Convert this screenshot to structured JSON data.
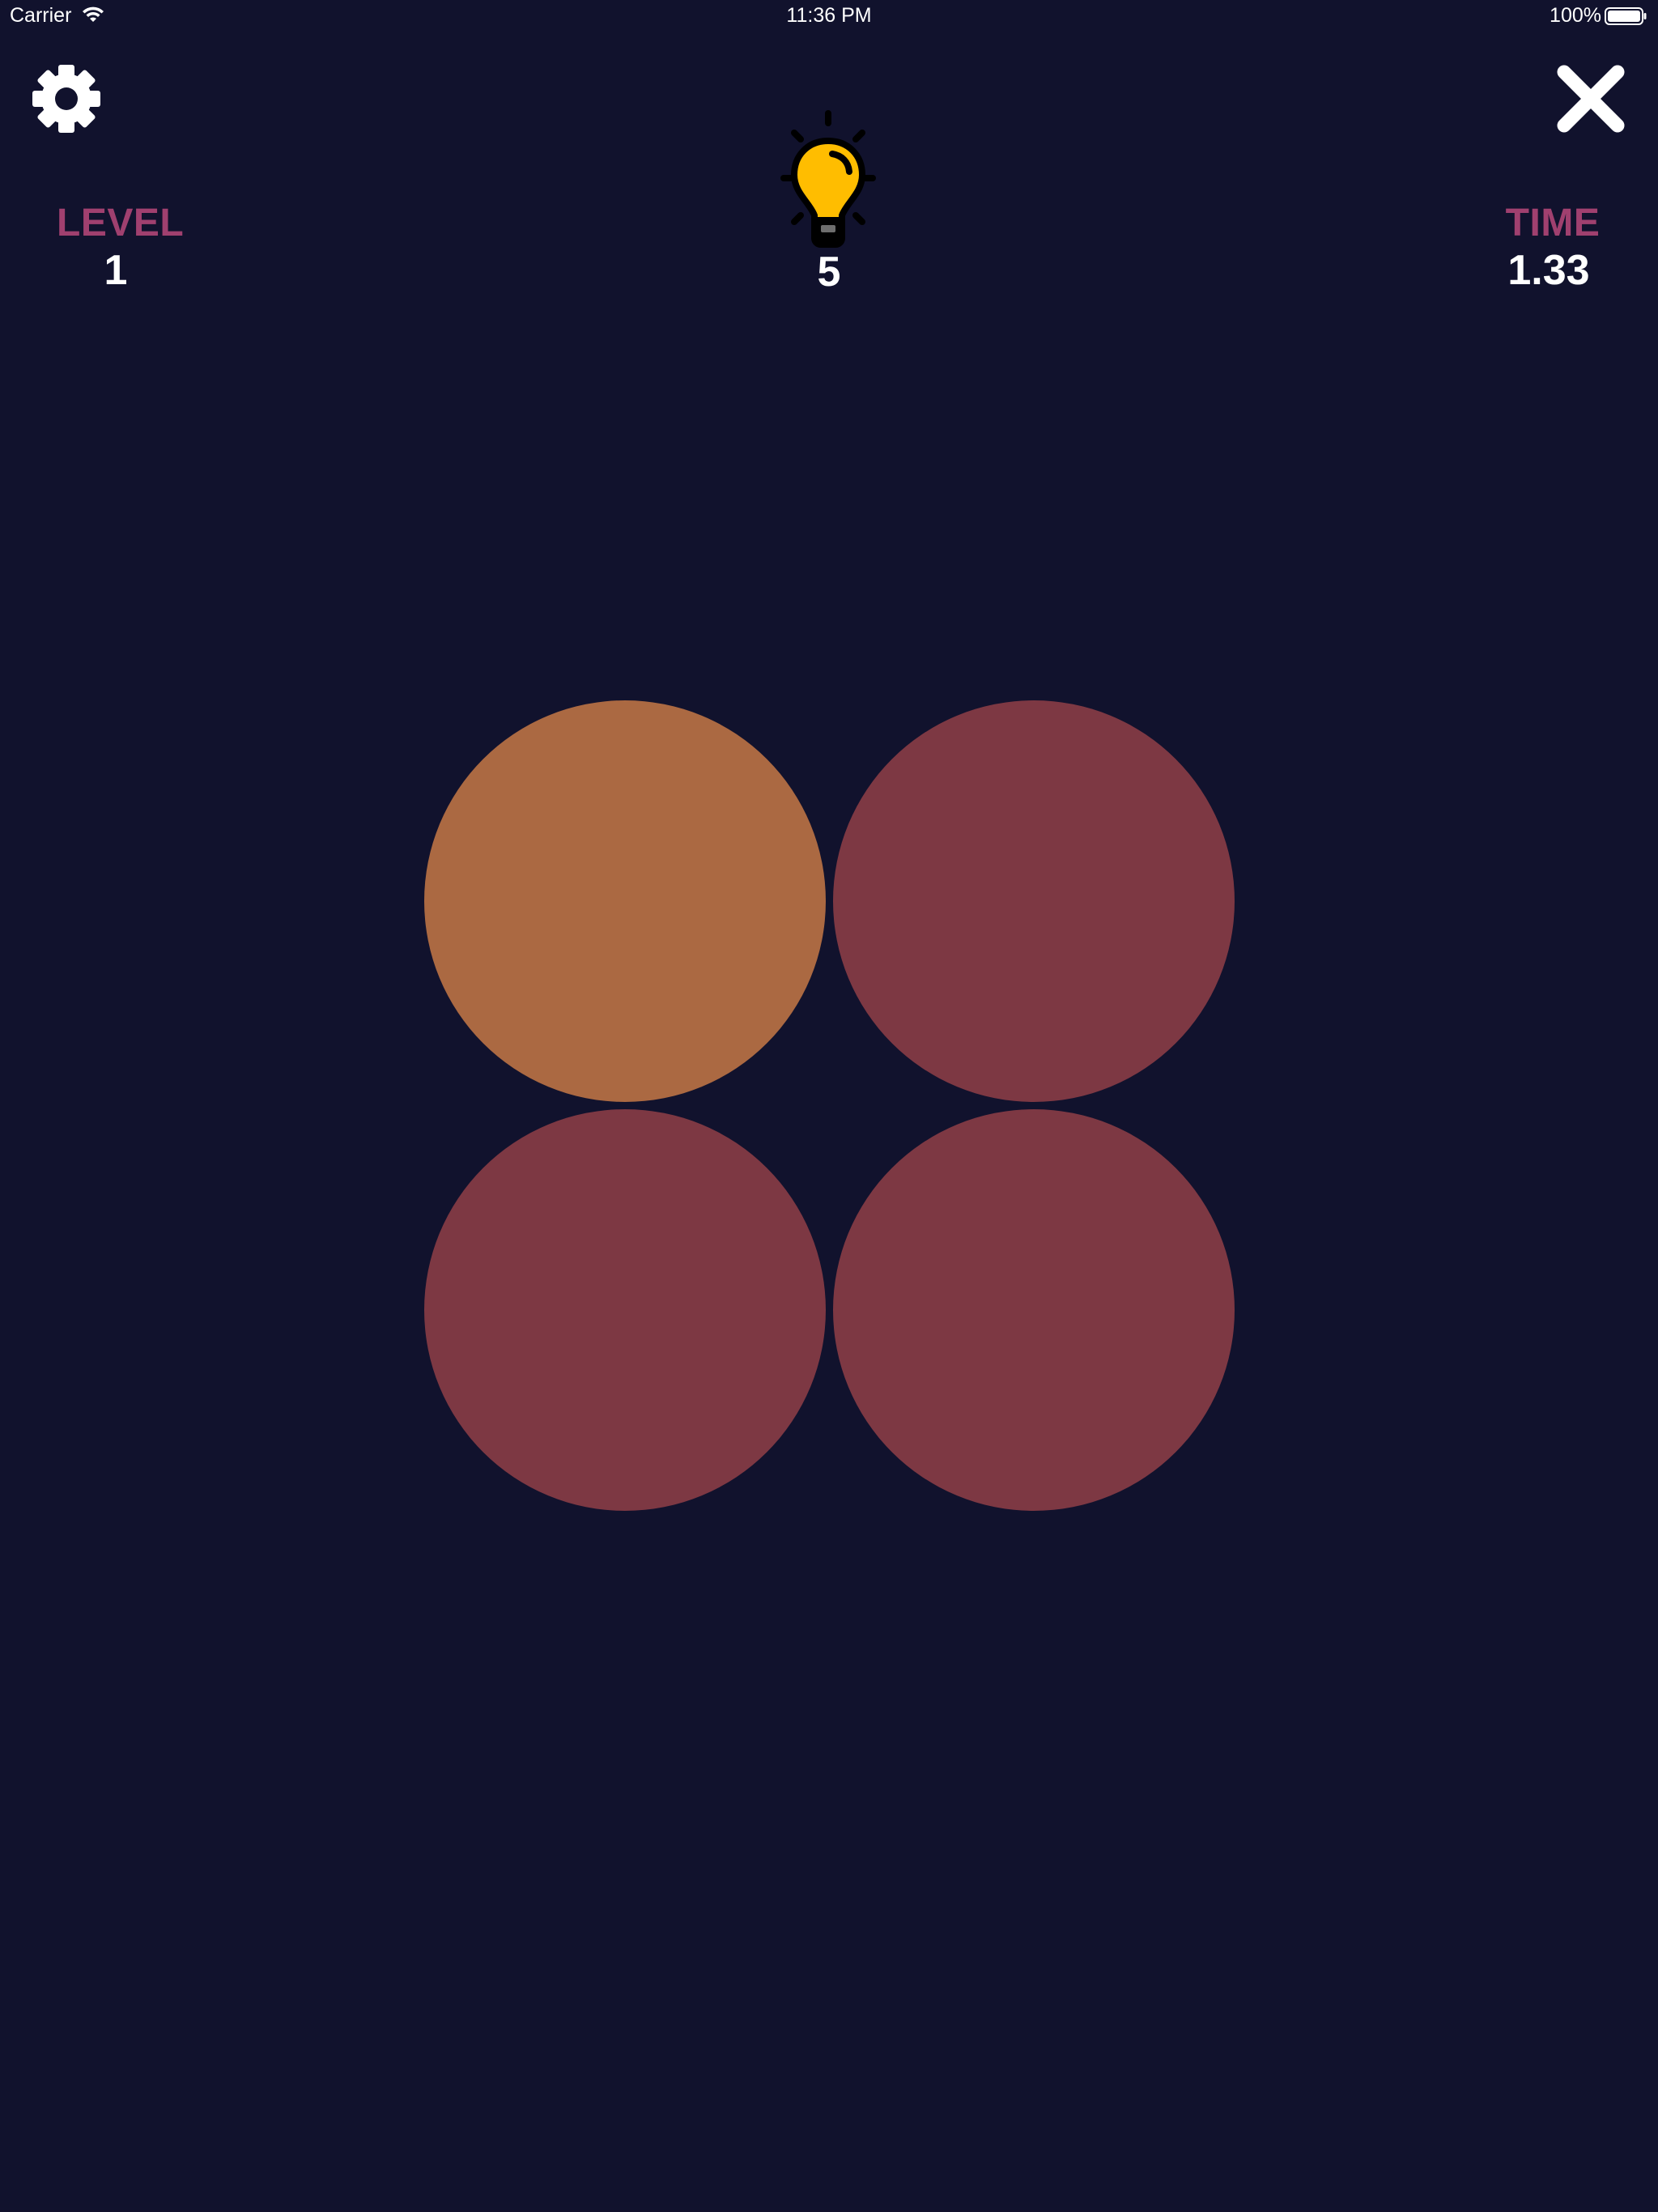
{
  "status_bar": {
    "carrier": "Carrier",
    "time": "11:36 PM",
    "battery": "100%"
  },
  "header": {
    "settings_icon": "gear-icon",
    "close_icon": "close-icon",
    "hint_icon": "lightbulb-icon",
    "level_label": "LEVEL",
    "level_value": "1",
    "time_label": "TIME",
    "time_value": "1.33",
    "hints_value": "5"
  },
  "colors": {
    "background": "#11122d",
    "label_accent": "#a0406f",
    "bulb": "#ffbd00",
    "odd_circle": "#ab6942",
    "base_circle": "#7d3843"
  },
  "grid": {
    "circles": [
      {
        "color": "#ab6942"
      },
      {
        "color": "#7d3843"
      },
      {
        "color": "#7d3843"
      },
      {
        "color": "#7d3843"
      }
    ]
  }
}
